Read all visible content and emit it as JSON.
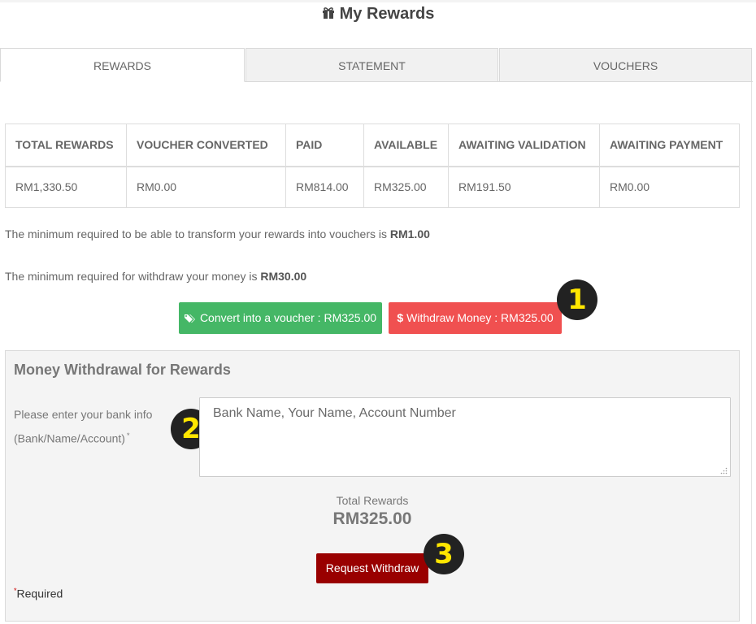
{
  "page": {
    "title": "My Rewards",
    "title_icon": "gift-icon"
  },
  "tabs": [
    {
      "label": "REWARDS",
      "active": true
    },
    {
      "label": "STATEMENT",
      "active": false
    },
    {
      "label": "VOUCHERS",
      "active": false
    }
  ],
  "summary": {
    "headers": [
      "TOTAL REWARDS",
      "VOUCHER CONVERTED",
      "PAID",
      "AVAILABLE",
      "AWAITING VALIDATION",
      "AWAITING PAYMENT"
    ],
    "values": [
      "RM1,330.50",
      "RM0.00",
      "RM814.00",
      "RM325.00",
      "RM191.50",
      "RM0.00"
    ]
  },
  "notes": {
    "voucher_min_text": "The minimum required to be able to transform your rewards into vouchers is ",
    "voucher_min_value": "RM1.00",
    "withdraw_min_text": "The minimum required for withdraw your money is ",
    "withdraw_min_value": "RM30.00"
  },
  "actions": {
    "convert_label": "Convert into a voucher : RM325.00",
    "convert_icon": "tags-icon",
    "withdraw_symbol": "$",
    "withdraw_label": "Withdraw Money : RM325.00"
  },
  "callouts": [
    "1",
    "2",
    "3"
  ],
  "withdrawal_form": {
    "title": "Money Withdrawal for Rewards",
    "label_line1": "Please enter your bank info",
    "label_line2": "(Bank/Name/Account)",
    "label_required_mark": "*",
    "bank_info_placeholder": "Bank Name, Your Name, Account Number",
    "bank_info_value": "",
    "total_label": "Total Rewards",
    "total_value": "RM325.00",
    "submit_label": "Request Withdraw",
    "required_mark": "*",
    "required_text": "Required"
  },
  "colors": {
    "convert_button": "#45b766",
    "withdraw_button": "#f05050",
    "request_button": "#990000",
    "callout_bg": "#222222",
    "callout_text": "#ffe600"
  }
}
